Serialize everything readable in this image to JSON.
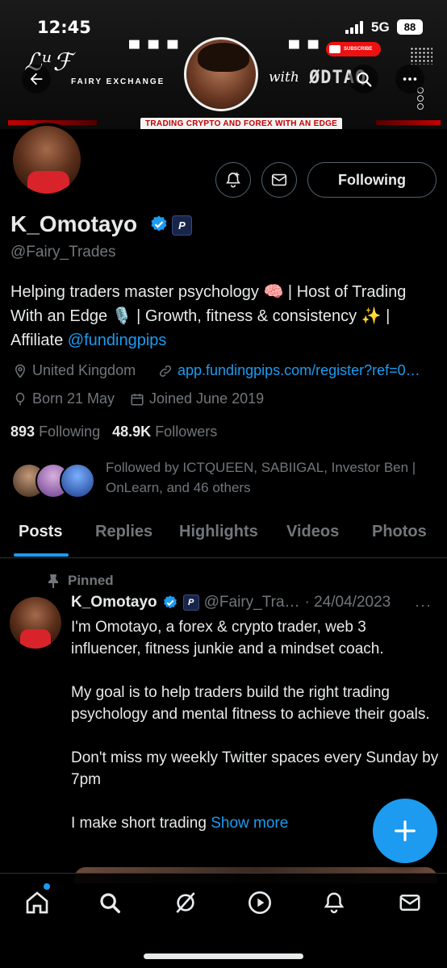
{
  "status_bar": {
    "time": "12:45",
    "network": "5G",
    "battery": "88"
  },
  "banner": {
    "logo_script": "ℒᵘℱ",
    "logo_text": "FAIRY EXCHANGE",
    "with_text": "with",
    "brand2": "ØDTAQ",
    "youtube_label": "SUBSCRIBE",
    "tagline": "TRADING CRYPTO AND FOREX WITH AN EDGE"
  },
  "profile": {
    "name": "K_Omotayo",
    "affiliate_badge": "P",
    "handle": "@Fairy_Trades",
    "follow_button": "Following",
    "bio_line1": "Helping traders master psychology 🧠 | Host of Trading With an Edge 🎙️ | Growth, fitness & consistency ✨ | Affiliate ",
    "bio_link": "@fundingpips",
    "location": "United Kingdom",
    "website": "app.fundingpips.com/register?ref=0…",
    "born": "Born 21 May",
    "joined": "Joined June 2019",
    "following_count": "893",
    "following_label": "Following",
    "followers_count": "48.9K",
    "followers_label": "Followers",
    "followed_by": "Followed by ICTQUEEN, SABIIGAL, Investor Ben | OnLearn, and 46 others"
  },
  "tabs": [
    {
      "label": "Posts"
    },
    {
      "label": "Replies"
    },
    {
      "label": "Highlights"
    },
    {
      "label": "Videos"
    },
    {
      "label": "Photos"
    }
  ],
  "post": {
    "pinned_label": "Pinned",
    "author": "K_Omotayo",
    "handle": "@Fairy_Tra…",
    "date": "· 24/04/2023",
    "more": "···",
    "para1": "I'm Omotayo, a forex & crypto trader, web 3 influencer, fitness junkie and a mindset coach.",
    "para2": "My goal is to help traders build the right trading psychology and mental fitness to achieve their goals.",
    "para3": "Don't miss my weekly Twitter spaces every Sunday by 7pm",
    "para4": "I make short trading ",
    "show_more": "Show more"
  },
  "icons": {
    "back": "arrow-left-icon",
    "search": "search-icon",
    "more": "more-vertical-icon",
    "notify": "bell-plus-icon",
    "message": "envelope-icon",
    "verified": "verified-badge-icon",
    "location": "location-pin-icon",
    "link": "link-icon",
    "born": "balloon-icon",
    "calendar": "calendar-icon",
    "pin": "pin-icon",
    "compose": "plus-icon",
    "nav": [
      "home-icon",
      "search-icon",
      "grok-icon",
      "play-icon",
      "bell-icon",
      "mail-icon"
    ]
  },
  "colors": {
    "accent": "#1d9bf0",
    "background": "#000000",
    "muted": "#71767b",
    "text": "#e7e9ea"
  }
}
